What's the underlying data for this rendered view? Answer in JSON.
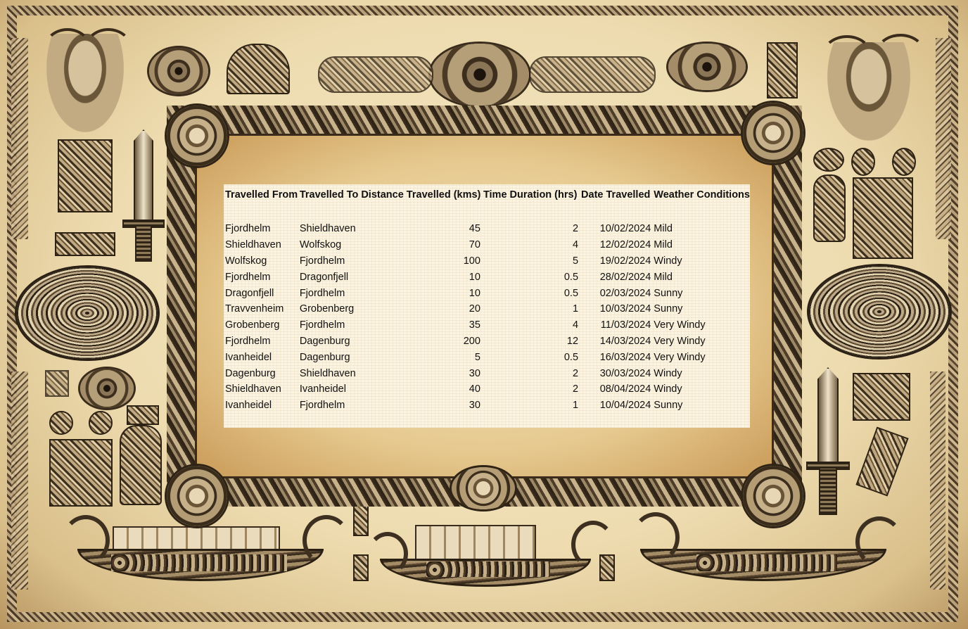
{
  "table": {
    "headers": [
      "Travelled From",
      "Travelled To",
      "Distance Travelled (kms)",
      "Time Duration (hrs)",
      "Date Travelled",
      "Weather Conditions"
    ],
    "rows": [
      [
        "Fjordhelm",
        "Shieldhaven",
        "45",
        "2",
        "10/02/2024",
        "Mild"
      ],
      [
        "Shieldhaven",
        "Wolfskog",
        "70",
        "4",
        "12/02/2024",
        "Mild"
      ],
      [
        "Wolfskog",
        "Fjordhelm",
        "100",
        "5",
        "19/02/2024",
        "Windy"
      ],
      [
        "Fjordhelm",
        "Dragonfjell",
        "10",
        "0.5",
        "28/02/2024",
        "Mild"
      ],
      [
        "Dragonfjell",
        "Fjordhelm",
        "10",
        "0.5",
        "02/03/2024",
        "Sunny"
      ],
      [
        "Travvenheim",
        "Grobenberg",
        "20",
        "1",
        "10/03/2024",
        "Sunny"
      ],
      [
        "Grobenberg",
        "Fjordhelm",
        "35",
        "4",
        "11/03/2024",
        "Very Windy"
      ],
      [
        "Fjordhelm",
        "Dagenburg",
        "200",
        "12",
        "14/03/2024",
        "Very Windy"
      ],
      [
        "Ivanheidel",
        "Dagenburg",
        "5",
        "0.5",
        "16/03/2024",
        "Very Windy"
      ],
      [
        "Dagenburg",
        "Shieldhaven",
        "30",
        "2",
        "30/03/2024",
        "Windy"
      ],
      [
        "Shieldhaven",
        "Ivanheidel",
        "40",
        "2",
        "08/04/2024",
        "Windy"
      ],
      [
        "Ivanheidel",
        "Fjordhelm",
        "30",
        "1",
        "10/04/2024",
        "Sunny"
      ]
    ]
  },
  "colors": {
    "parchment": "#f3e2bb",
    "ink": "#111111",
    "frame": "#3a2c1c"
  },
  "decorations": {
    "icons": [
      "viking-head-icon",
      "shield-icon",
      "sword-icon",
      "celtic-knot-icon",
      "longship-icon",
      "rune-tile-icon"
    ]
  }
}
